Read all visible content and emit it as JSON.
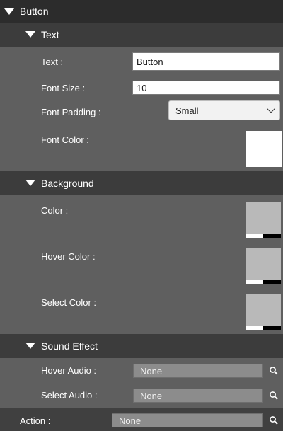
{
  "button_section": {
    "title": "Button"
  },
  "text_section": {
    "title": "Text",
    "text_label": "Text :",
    "text_value": "Button",
    "font_size_label": "Font Size :",
    "font_size_value": "10",
    "font_padding_label": "Font Padding :",
    "font_padding_value": "Small",
    "font_color_label": "Font Color :",
    "font_color": "#ffffff"
  },
  "background_section": {
    "title": "Background",
    "color_label": "Color :",
    "hover_color_label": "Hover Color :",
    "select_color_label": "Select Color :",
    "color": "#b9b9b9",
    "hover_color": "#b9b9b9",
    "select_color": "#b9b9b9"
  },
  "sound_section": {
    "title": "Sound Effect",
    "hover_audio_label": "Hover Audio :",
    "hover_audio_value": "None",
    "select_audio_label": "Select Audio :",
    "select_audio_value": "None"
  },
  "action": {
    "label": "Action :",
    "value": "None"
  },
  "icons": {
    "collapse": "triangle-down-icon",
    "search": "magnifier-icon",
    "dropdown": "chevron-down-icon"
  }
}
